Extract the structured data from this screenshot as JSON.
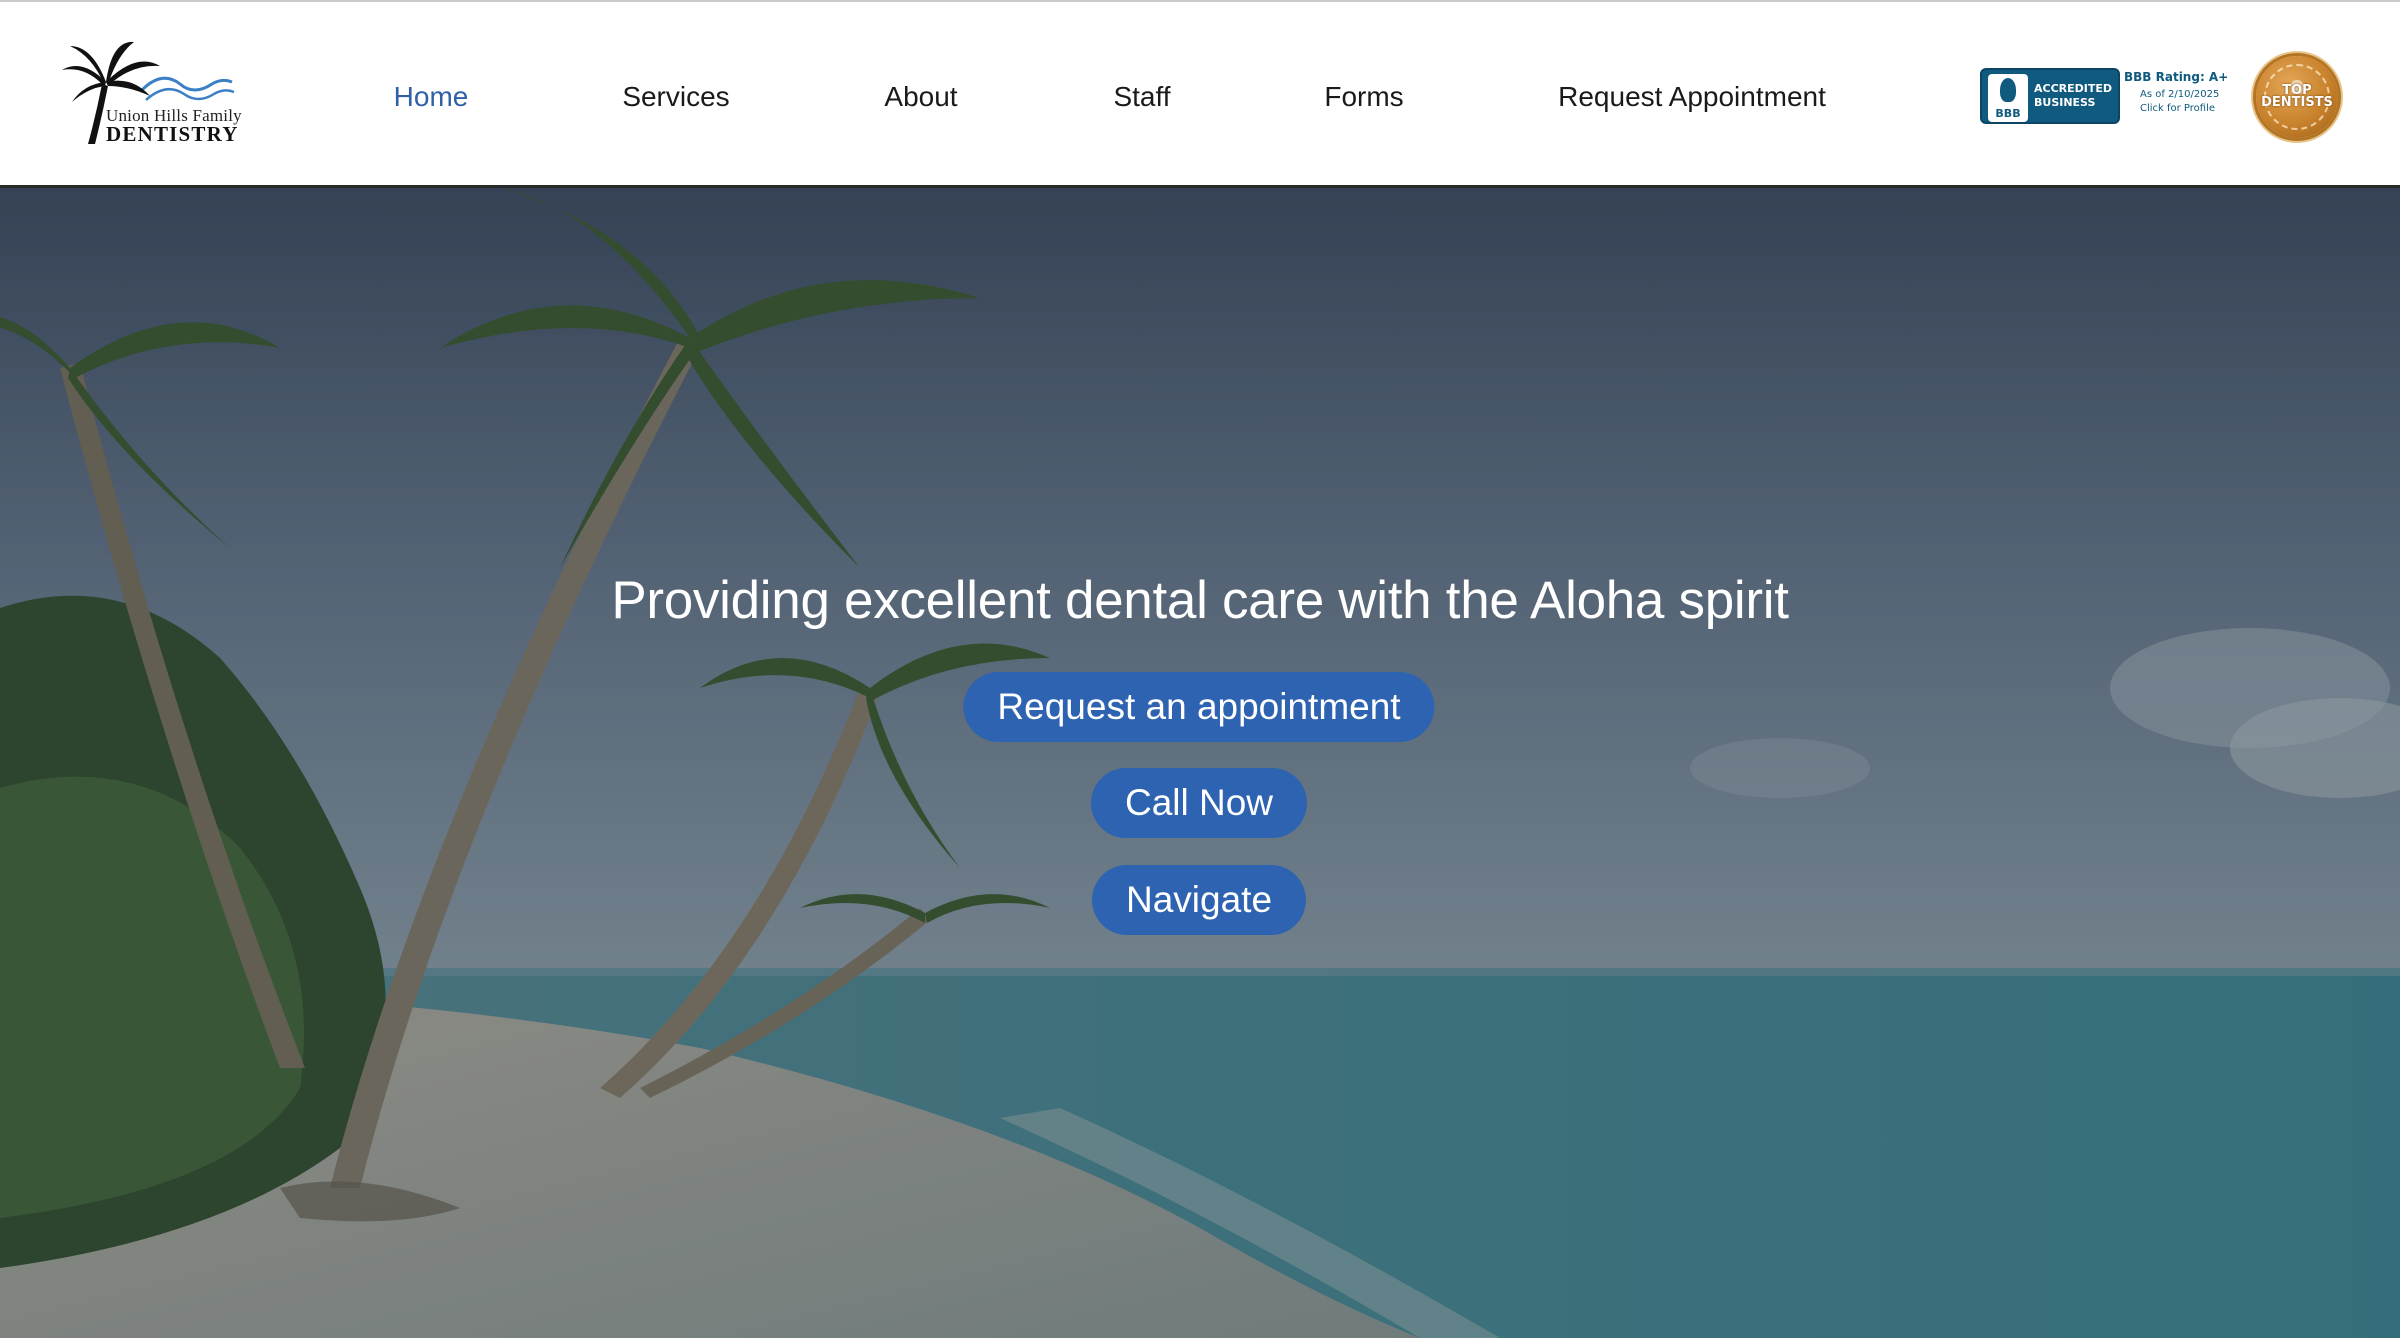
{
  "logo": {
    "line1": "Union Hills Family",
    "line2": "DENTISTRY"
  },
  "nav": {
    "items": [
      {
        "label": "Home",
        "active": true
      },
      {
        "label": "Services",
        "active": false
      },
      {
        "label": "About",
        "active": false
      },
      {
        "label": "Staff",
        "active": false
      },
      {
        "label": "Forms",
        "active": false
      },
      {
        "label": "Request Appointment",
        "active": false
      }
    ]
  },
  "bbb": {
    "torch_label": "BBB",
    "accredited": "ACCREDITED",
    "business": "BUSINESS",
    "rating": "BBB Rating: A+",
    "as_of": "As of 2/10/2025",
    "click": "Click for Profile"
  },
  "seal": {
    "top": "TOP",
    "bottom": "DENTISTS"
  },
  "hero": {
    "tagline": "Providing excellent dental care with the Aloha spirit",
    "buttons": {
      "request": "Request an appointment",
      "call": "Call Now",
      "navigate": "Navigate"
    }
  },
  "colors": {
    "accent": "#2f61a6",
    "button": "#2d63b1",
    "nav_text": "#1a1a1a",
    "header_border": "#2a2a2a"
  }
}
